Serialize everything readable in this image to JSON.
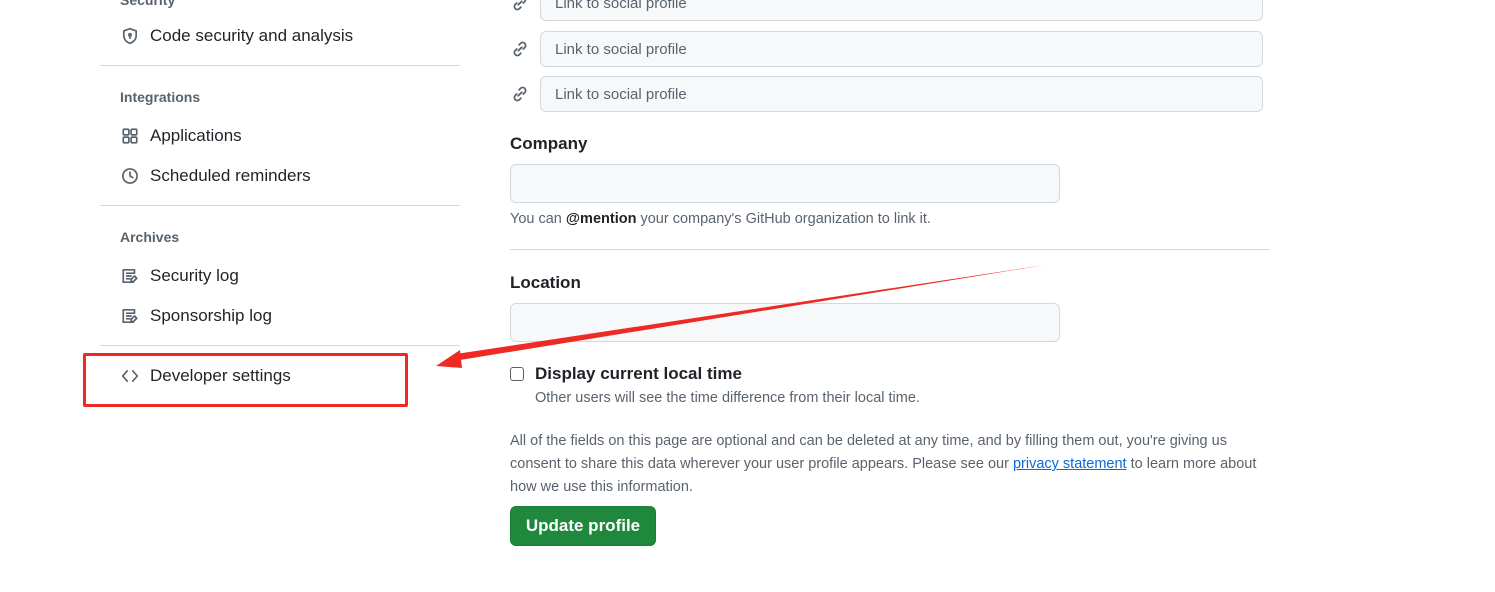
{
  "sidebar": {
    "sections": [
      {
        "heading": "Security",
        "items": [
          {
            "label": "Code security and analysis",
            "icon": "shield-icon"
          }
        ]
      },
      {
        "heading": "Integrations",
        "items": [
          {
            "label": "Applications",
            "icon": "apps-grid-icon"
          },
          {
            "label": "Scheduled reminders",
            "icon": "clock-icon"
          }
        ]
      },
      {
        "heading": "Archives",
        "items": [
          {
            "label": "Security log",
            "icon": "log-icon"
          },
          {
            "label": "Sponsorship log",
            "icon": "log-icon"
          }
        ]
      }
    ],
    "developer_settings": {
      "label": "Developer settings",
      "icon": "code-icon"
    }
  },
  "profile_form": {
    "social_links": [
      {
        "placeholder": "Link to social profile",
        "value": ""
      },
      {
        "placeholder": "Link to social profile",
        "value": ""
      },
      {
        "placeholder": "Link to social profile",
        "value": ""
      }
    ],
    "company": {
      "label": "Company",
      "value": "",
      "note_prefix": "You can ",
      "note_mention": "@mention",
      "note_suffix": " your company's GitHub organization to link it."
    },
    "location": {
      "label": "Location",
      "value": ""
    },
    "local_time": {
      "label": "Display current local time",
      "note": "Other users will see the time difference from their local time.",
      "checked": false
    },
    "disclaimer": {
      "before_link": "All of the fields on this page are optional and can be deleted at any time, and by filling them out, you're giving us consent to share this data wherever your user profile appears. Please see our ",
      "link_text": "privacy statement",
      "after_link": " to learn more about how we use this information."
    },
    "update_button": "Update profile"
  },
  "annotation": {
    "color": "#ee2a24"
  },
  "colors": {
    "accent_green": "#1f883d",
    "link_blue": "#0969da",
    "muted_text": "#59636e"
  }
}
